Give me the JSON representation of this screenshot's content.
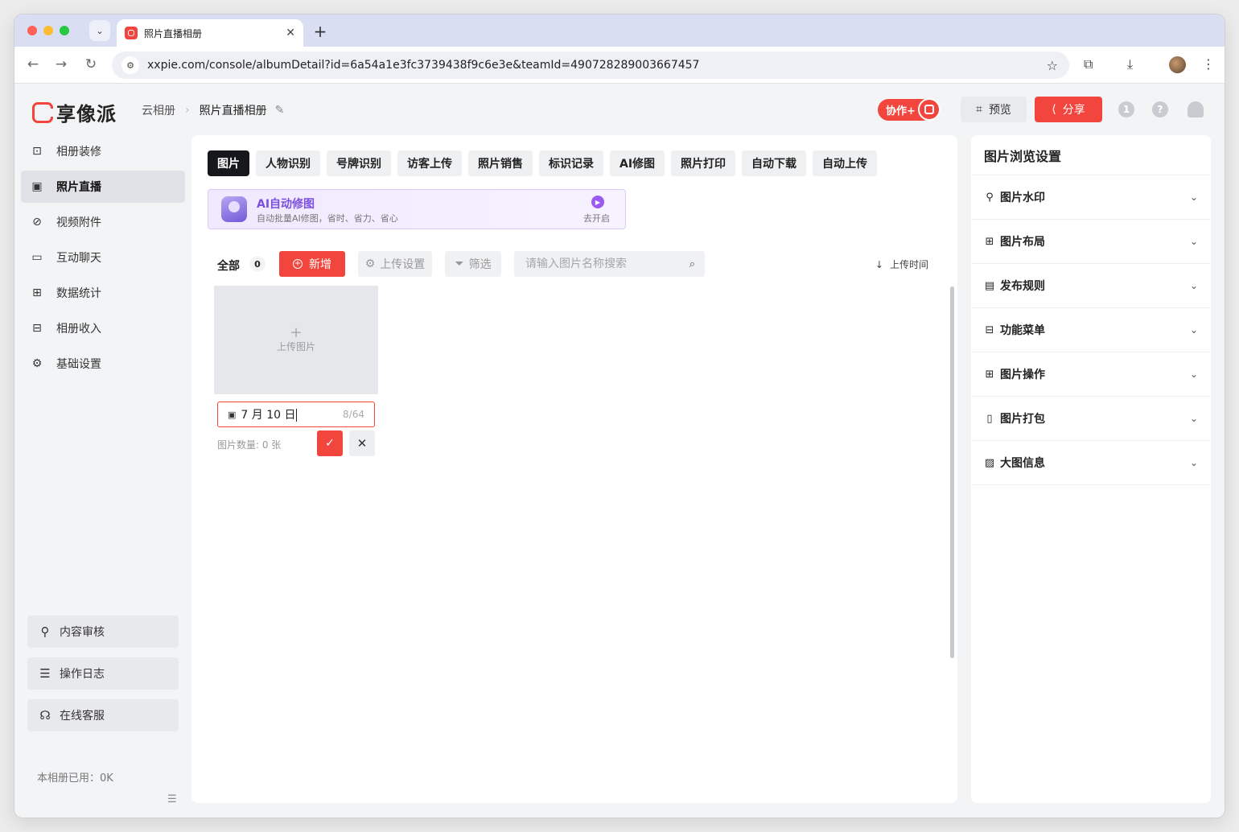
{
  "browser": {
    "tab_title": "照片直播相册",
    "url": "xxpie.com/console/albumDetail?id=6a54a1e3fc3739438f9c6e3e&teamId=490728289003667457"
  },
  "header": {
    "logo_text": "享像派",
    "breadcrumb_root": "云相册",
    "breadcrumb_current": "照片直播相册",
    "collab_label": "协作+",
    "preview_label": "预览",
    "share_label": "分享",
    "help_label": "?",
    "counter_label": "1"
  },
  "sidebar": {
    "items": [
      {
        "label": "相册装修",
        "icon": "layout-icon"
      },
      {
        "label": "照片直播",
        "icon": "image-icon"
      },
      {
        "label": "视频附件",
        "icon": "paperclip-icon"
      },
      {
        "label": "互动聊天",
        "icon": "chat-icon"
      },
      {
        "label": "数据统计",
        "icon": "stats-icon"
      },
      {
        "label": "相册收入",
        "icon": "wallet-icon"
      },
      {
        "label": "基础设置",
        "icon": "gear-icon"
      }
    ],
    "active_index": 1,
    "bottom_buttons": [
      {
        "label": "内容审核",
        "icon": "stamp-icon"
      },
      {
        "label": "操作日志",
        "icon": "log-icon"
      },
      {
        "label": "在线客服",
        "icon": "headset-icon"
      }
    ],
    "usage_text": "本相册已用：0K"
  },
  "main": {
    "tabs": [
      "图片",
      "人物识别",
      "号牌识别",
      "访客上传",
      "照片销售",
      "标识记录",
      "AI修图",
      "照片打印",
      "自动下载",
      "自动上传"
    ],
    "ai_banner": {
      "title": "AI自动修图",
      "subtitle": "自动批量AI修图，省时、省力、省心",
      "action": "去开启"
    },
    "toolbar": {
      "all_label": "全部",
      "count": "0",
      "add_label": "新增",
      "upload_settings_label": "上传设置",
      "filter_label": "筛选",
      "search_placeholder": "请输入图片名称搜索",
      "sort_label": "上传时间"
    },
    "upload_tile": {
      "plus": "+",
      "label": "上传图片"
    },
    "name_editor": {
      "value": "7 月 10 日",
      "counter": "8/64",
      "photo_count": "图片数量: 0 张"
    }
  },
  "right_panel": {
    "title": "图片浏览设置",
    "sections": [
      {
        "label": "图片水印",
        "icon": "stamp-icon"
      },
      {
        "label": "图片布局",
        "icon": "grid-layout-icon"
      },
      {
        "label": "发布规则",
        "icon": "rules-icon"
      },
      {
        "label": "功能菜单",
        "icon": "menu-icon"
      },
      {
        "label": "图片操作",
        "icon": "apps-icon"
      },
      {
        "label": "图片打包",
        "icon": "zip-icon"
      },
      {
        "label": "大图信息",
        "icon": "image-info-icon"
      }
    ]
  },
  "colors": {
    "accent": "#f2453d",
    "ai_purple": "#7b4fe0",
    "active_tab": "#17181c"
  }
}
